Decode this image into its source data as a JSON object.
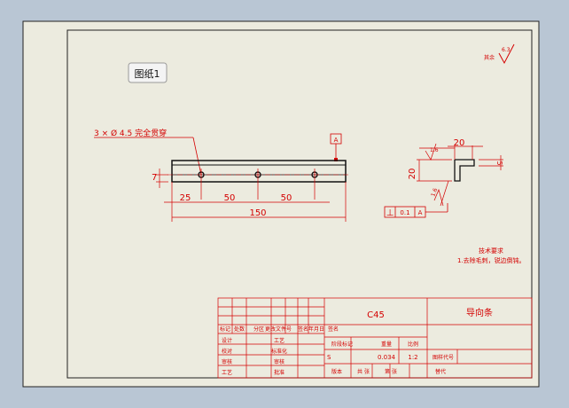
{
  "sheet_tab": "图纸1",
  "hole_callout": "3 × Ø 4.5 完全贯穿",
  "datum": "A",
  "dimensions": {
    "a": "25",
    "b": "50",
    "c": "50",
    "overall": "150",
    "height": "7",
    "profile_width": "20",
    "profile_height": "20",
    "profile_small": "5",
    "roughness_1": "1.6",
    "roughness_2": "1.6",
    "roughness_corner": "6.3"
  },
  "corner_mark": "其余",
  "tolerance": {
    "symbol": "⊥",
    "value": "0.1",
    "datum": "A"
  },
  "notes": {
    "title": "技术要求",
    "line1": "1.去除毛刺，锐边倒钝。"
  },
  "title_block": {
    "material": "C45",
    "part_name": "导向条",
    "header_cells": [
      "标记",
      "处数",
      "分区",
      "更改文件号",
      "签名",
      "年月日"
    ],
    "row_labels": [
      "设计",
      "校对",
      "审核",
      "工艺"
    ],
    "middle_labels": [
      "工艺",
      "标准化",
      "审核",
      "批准"
    ],
    "stage_header": [
      "阶段标记",
      "重量",
      "比例"
    ],
    "stage_s": "S",
    "weight": "0.034",
    "scale": "1:2",
    "bottom": [
      "共 张",
      "第 张",
      "版本",
      "替代"
    ],
    "sign_label": "签名",
    "drawing_no_label": "图样代号"
  }
}
